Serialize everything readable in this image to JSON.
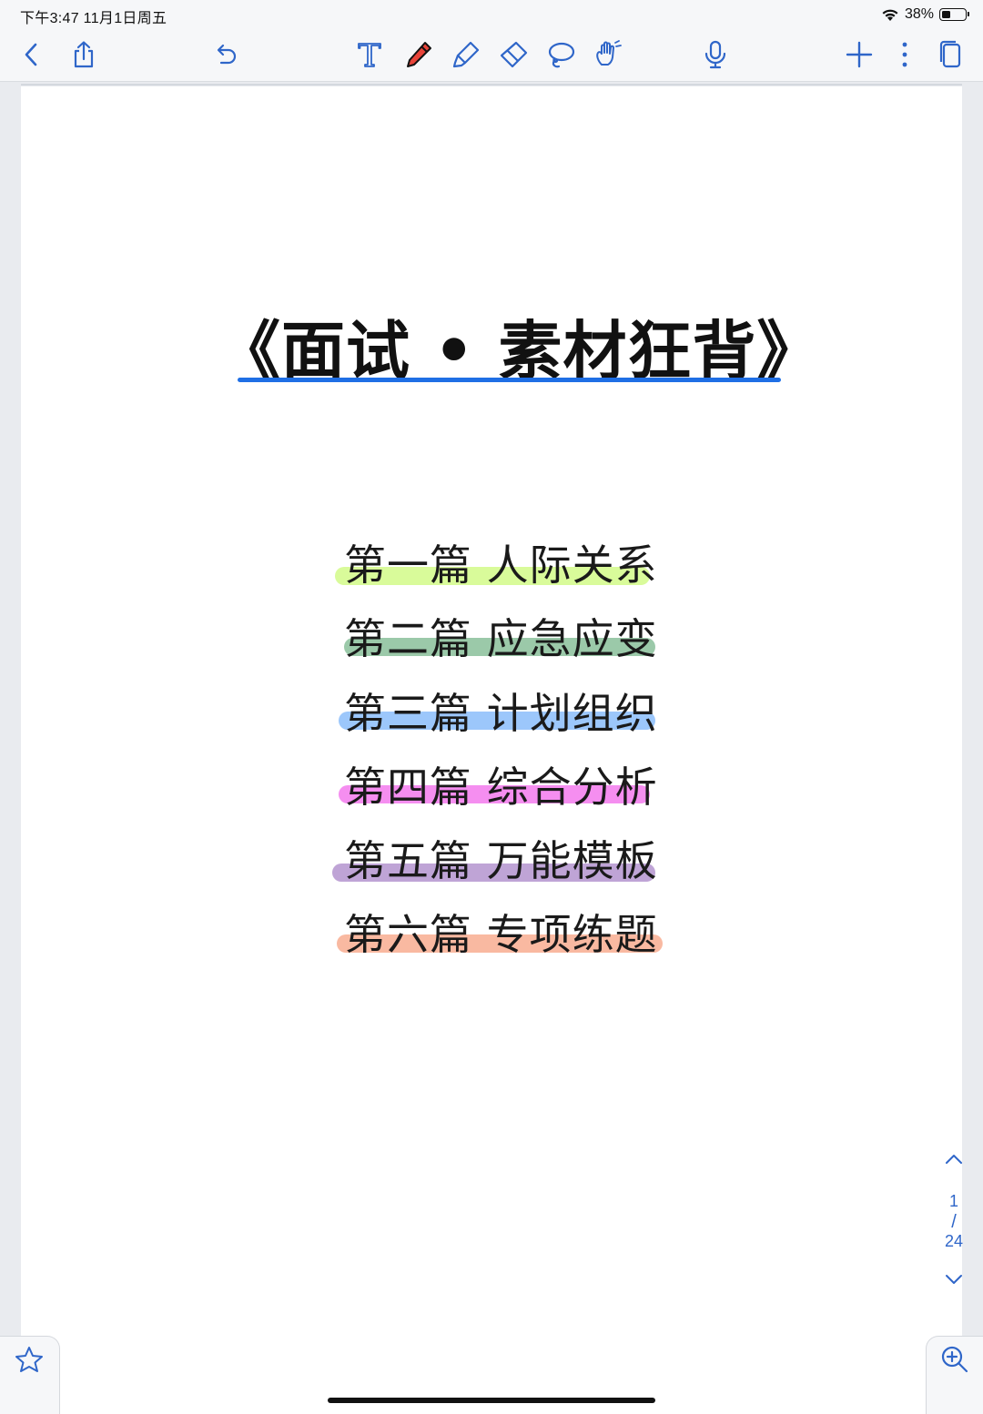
{
  "status_bar": {
    "time_date": "下午3:47   11月1日周五",
    "battery_percent": "38%",
    "battery_level": 0.38
  },
  "toolbar": {
    "icons": [
      "back-icon",
      "share-icon",
      "undo-icon",
      "text-tool-icon",
      "pen-icon",
      "highlighter-icon",
      "eraser-icon",
      "lasso-icon",
      "hand-icon",
      "microphone-icon",
      "add-icon",
      "more-icon",
      "pages-icon"
    ],
    "accent": "#2f66c9",
    "pen_color": "#e8443a"
  },
  "document": {
    "title": "《面试 • 素材狂背》",
    "title_underline_color": "#1f6fe5",
    "chapters": [
      {
        "label": "第一篇  人际关系",
        "highlight": "#d9fb9a"
      },
      {
        "label": "第二篇  应急应变",
        "highlight": "#9bc9a9"
      },
      {
        "label": "第三篇  计划组织",
        "highlight": "#9cc7fb"
      },
      {
        "label": "第四篇  综合分析",
        "highlight": "#f58ef0"
      },
      {
        "label": "第五篇  万能模板",
        "highlight": "#bfa4d6"
      },
      {
        "label": "第六篇  专项练题",
        "highlight": "#f9b9a1"
      }
    ]
  },
  "pager": {
    "current": "1",
    "separator": "/",
    "total": "24"
  }
}
